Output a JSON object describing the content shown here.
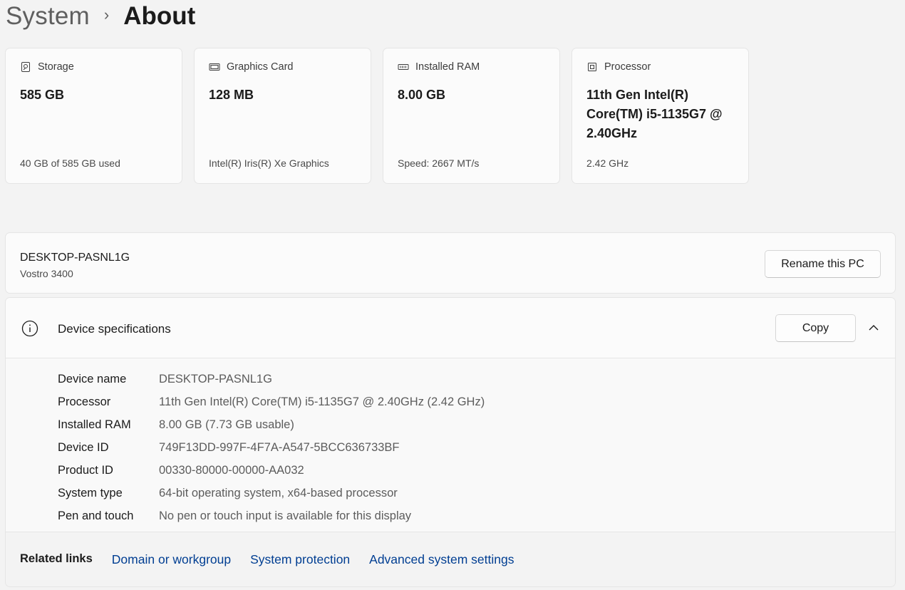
{
  "breadcrumb": {
    "parent": "System",
    "separator": "›",
    "current": "About"
  },
  "cards": [
    {
      "icon": "storage-icon",
      "label": "Storage",
      "value": "585 GB",
      "sub": "40 GB of 585 GB used"
    },
    {
      "icon": "graphics-card-icon",
      "label": "Graphics Card",
      "value": "128 MB",
      "sub": "Intel(R) Iris(R) Xe Graphics"
    },
    {
      "icon": "ram-icon",
      "label": "Installed RAM",
      "value": "8.00 GB",
      "sub": "Speed: 2667 MT/s"
    },
    {
      "icon": "processor-icon",
      "label": "Processor",
      "value": "11th Gen Intel(R) Core(TM) i5-1135G7 @ 2.40GHz",
      "sub": "2.42 GHz"
    }
  ],
  "pc": {
    "name": "DESKTOP-PASNL1G",
    "model": "Vostro 3400",
    "rename_label": "Rename this PC"
  },
  "specs": {
    "title": "Device specifications",
    "copy_label": "Copy",
    "rows": [
      {
        "key": "Device name",
        "value": "DESKTOP-PASNL1G"
      },
      {
        "key": "Processor",
        "value": "11th Gen Intel(R) Core(TM) i5-1135G7 @ 2.40GHz (2.42 GHz)"
      },
      {
        "key": "Installed RAM",
        "value": "8.00 GB (7.73 GB usable)"
      },
      {
        "key": "Device ID",
        "value": "749F13DD-997F-4F7A-A547-5BCC636733BF"
      },
      {
        "key": "Product ID",
        "value": "00330-80000-00000-AA032"
      },
      {
        "key": "System type",
        "value": "64-bit operating system, x64-based processor"
      },
      {
        "key": "Pen and touch",
        "value": "No pen or touch input is available for this display"
      }
    ]
  },
  "related": {
    "label": "Related links",
    "links": [
      "Domain or workgroup",
      "System protection",
      "Advanced system settings"
    ]
  },
  "colors": {
    "link": "#003e92",
    "background": "#f3f3f3",
    "card": "#fbfbfb"
  }
}
